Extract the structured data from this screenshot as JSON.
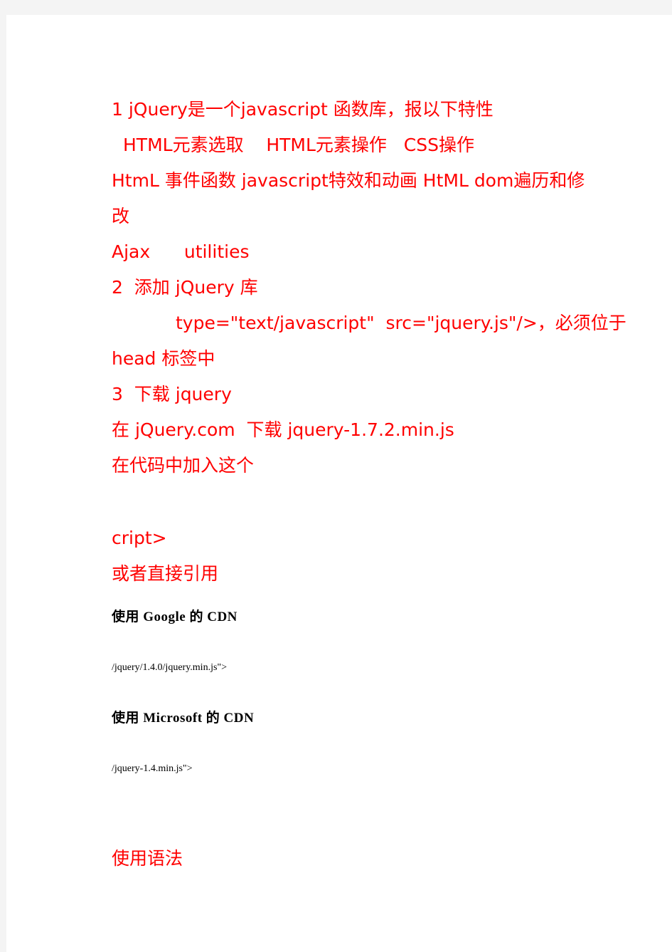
{
  "page": {
    "background_color": "#ffffff",
    "margin_band_color": "#f4f4f4",
    "accent_color": "#ff0000",
    "text_color": "#000000"
  },
  "document": {
    "lines": [
      {
        "id": "l1",
        "text": "1 jQuery是一个javascript 函数库，报以下特性"
      },
      {
        "id": "l2",
        "text": "HTML元素选取    HTML元素操作   CSS操作"
      },
      {
        "id": "l3",
        "text": "HtmL 事件函数 javascript特效和动画 HtML dom遍历和修"
      },
      {
        "id": "l4",
        "text": "改"
      },
      {
        "id": "l5",
        "text": "Ajax      utilities"
      },
      {
        "id": "l6",
        "text": "2  添加 jQuery 库"
      },
      {
        "id": "l7",
        "text": "type=\"text/javascript\"  src=\"jquery.js\"/>，必须位于"
      },
      {
        "id": "l8",
        "text": "head 标签中"
      },
      {
        "id": "l9",
        "text": "3  下载 jquery"
      },
      {
        "id": "l10",
        "text": "在 jQuery.com  下载 jquery-1.7.2.min.js"
      },
      {
        "id": "l11",
        "text": "在代码中加入这个"
      },
      {
        "id": "l12",
        "text": "cript>"
      },
      {
        "id": "l13",
        "text": "或者直接引用"
      },
      {
        "id": "l14",
        "text": "使用 Google 的 CDN"
      },
      {
        "id": "l15",
        "text": "/jquery/1.4.0/jquery.min.js\">"
      },
      {
        "id": "l16",
        "text": "使用 Microsoft 的 CDN"
      },
      {
        "id": "l17",
        "text": "/jquery-1.4.min.js\">"
      },
      {
        "id": "l18",
        "text": "使用语法"
      }
    ]
  }
}
